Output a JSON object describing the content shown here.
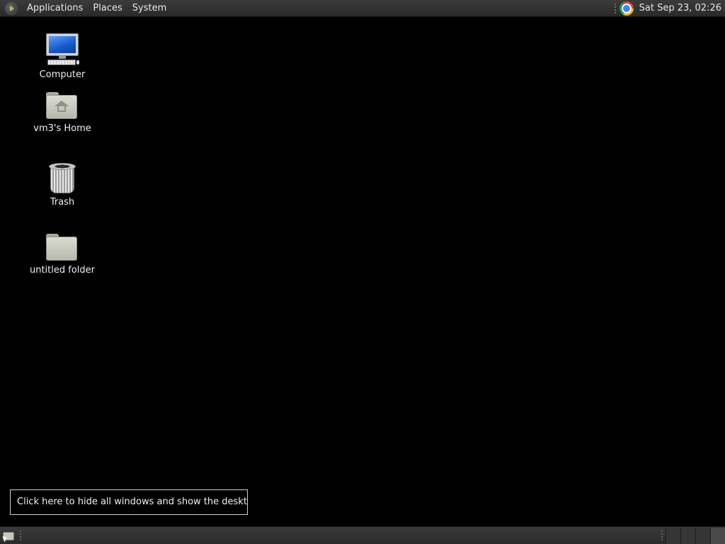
{
  "top_panel": {
    "menus": [
      "Applications",
      "Places",
      "System"
    ],
    "launcher_icon": "chrome-icon",
    "clock": "Sat Sep 23, 02:26"
  },
  "desktop_icons": [
    {
      "label": "Computer",
      "icon": "computer-icon"
    },
    {
      "label": "vm3's Home",
      "icon": "home-folder-icon"
    },
    {
      "label": "Trash",
      "icon": "trash-icon"
    },
    {
      "label": "untitled folder",
      "icon": "folder-icon"
    }
  ],
  "tooltip": {
    "text": "Click here to hide all windows and show the desktop."
  },
  "bottom_panel": {
    "show_desktop_icon": "show-desktop-icon",
    "workspace_count": 4,
    "active_workspace": 4
  },
  "colors": {
    "desktop_background": "#000000",
    "panel": "#333333",
    "text": "#f0f0f0"
  }
}
